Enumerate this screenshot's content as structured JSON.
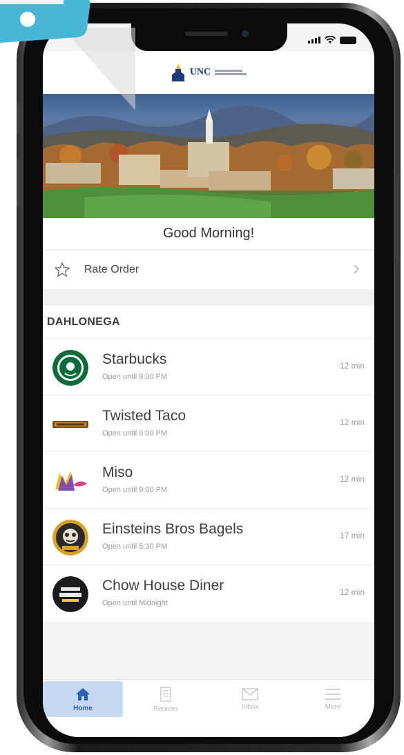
{
  "status_bar": {
    "signal_icon": "signal-icon",
    "wifi_icon": "wifi-icon",
    "battery_icon": "battery-icon"
  },
  "header": {
    "logo_text": "UNC",
    "logo_icon": "unc-tower-logo-icon"
  },
  "greeting": "Good Morning!",
  "rate_order": {
    "label": "Rate Order",
    "icon": "star-outline-icon",
    "chevron": "chevron-right-icon"
  },
  "section": {
    "title": "DAHLONEGA"
  },
  "restaurants": [
    {
      "name": "Starbucks",
      "hours": "Open until 9:00 PM",
      "time": "12 min",
      "logo": "starbucks-logo-icon"
    },
    {
      "name": "Twisted Taco",
      "hours": "Open until 9:00 PM",
      "time": "12 min",
      "logo": "twisted-taco-logo-icon"
    },
    {
      "name": "Miso",
      "hours": "Open until 9:00 PM",
      "time": "12 min",
      "logo": "miso-logo-icon"
    },
    {
      "name": "Einsteins Bros Bagels",
      "hours": "Open until 5:30 PM",
      "time": "17 min",
      "logo": "einstein-bros-logo-icon"
    },
    {
      "name": "Chow House Diner",
      "hours": "Open until Midnight",
      "time": "12 min",
      "logo": "chow-house-logo-icon"
    }
  ],
  "tabs": [
    {
      "label": "Home",
      "icon": "home-icon",
      "active": true
    },
    {
      "label": "Reorder",
      "icon": "receipt-icon",
      "active": false
    },
    {
      "label": "Inbox",
      "icon": "envelope-icon",
      "active": false
    },
    {
      "label": "More",
      "icon": "menu-icon",
      "active": false
    }
  ],
  "colors": {
    "accent": "#2b5fb5",
    "active_tab_bg": "#c6d8f2",
    "callout": "#4ab6d6"
  }
}
